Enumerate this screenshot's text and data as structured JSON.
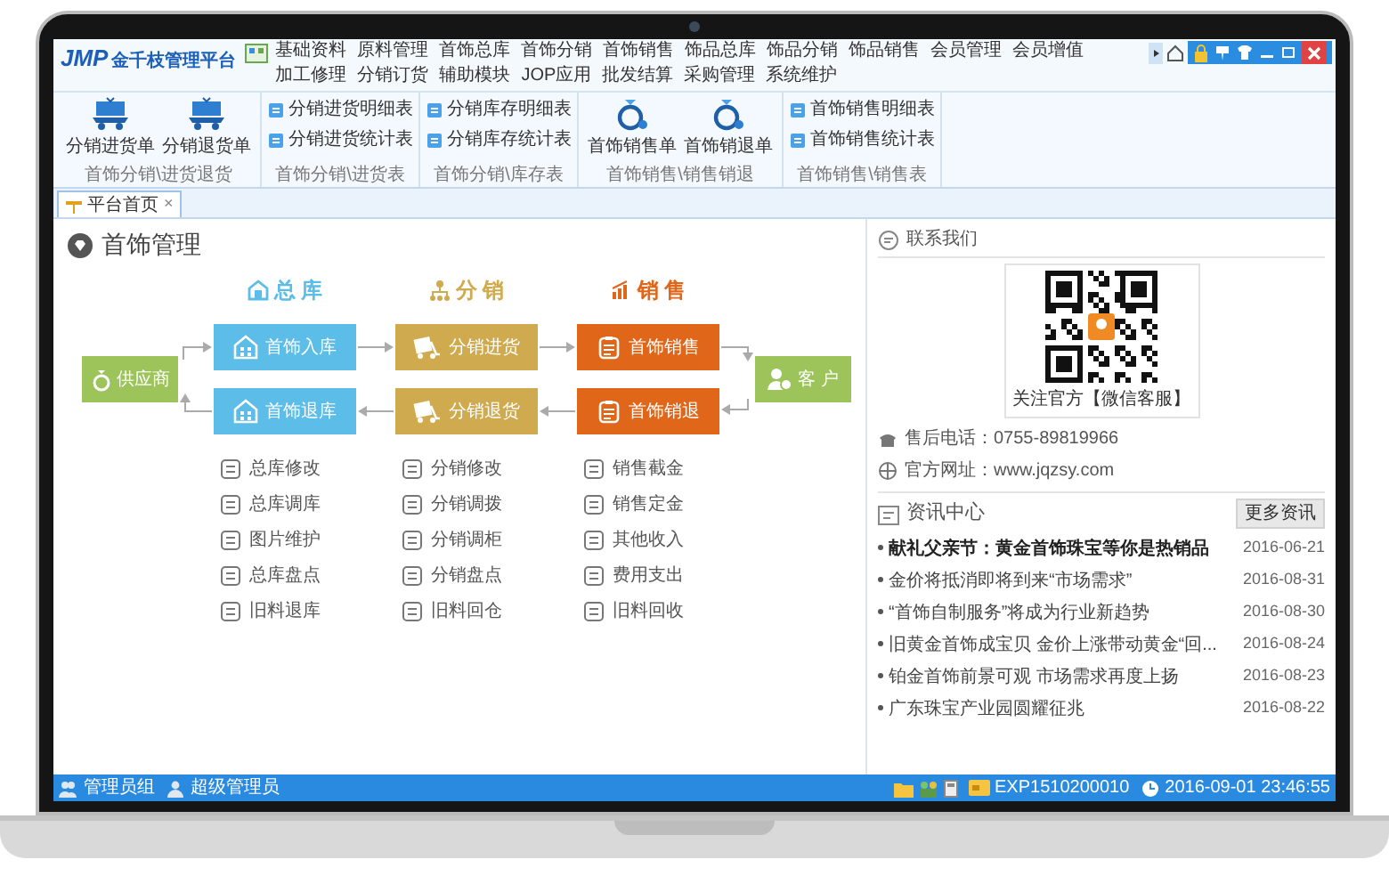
{
  "app": {
    "logo": "JMP",
    "title": "金千枝管理平台"
  },
  "menu": [
    "基础资料",
    "原料管理",
    "首饰总库",
    "首饰分销",
    "首饰销售",
    "饰品总库",
    "饰品分销",
    "饰品销售",
    "会员管理",
    "会员增值",
    "加工修理",
    "分销订货",
    "辅助模块",
    "JOP应用",
    "批发结算",
    "采购管理",
    "系统维护"
  ],
  "ribbon_groups": [
    {
      "label": "首饰分销\\进货退货",
      "items": [
        {
          "label": "分销进货单",
          "kind": "large"
        },
        {
          "label": "分销退货单",
          "kind": "large"
        }
      ]
    },
    {
      "label": "首饰分销\\进货表",
      "items": [
        {
          "label": "分销进货明细表",
          "kind": "small"
        },
        {
          "label": "分销进货统计表",
          "kind": "small"
        }
      ]
    },
    {
      "label": "首饰分销\\库存表",
      "items": [
        {
          "label": "分销库存明细表",
          "kind": "small"
        },
        {
          "label": "分销库存统计表",
          "kind": "small"
        }
      ]
    },
    {
      "label": "首饰销售\\销售销退",
      "items": [
        {
          "label": "首饰销售单",
          "kind": "large"
        },
        {
          "label": "首饰销退单",
          "kind": "large"
        }
      ]
    },
    {
      "label": "首饰销售\\销售表",
      "items": [
        {
          "label": "首饰销售明细表",
          "kind": "small"
        },
        {
          "label": "首饰销售统计表",
          "kind": "small"
        }
      ]
    }
  ],
  "tabs": [
    {
      "label": "平台首页",
      "selected": true,
      "close": "×"
    }
  ],
  "page_title": "首饰管理",
  "flow": {
    "supplier": "供应商",
    "customer": "客 户",
    "columns": [
      {
        "title": "总 库",
        "color": "#5bbde8",
        "forward": "首饰入库",
        "back": "首饰退库",
        "functions": [
          "总库修改",
          "总库调库",
          "图片维护",
          "总库盘点",
          "旧料退库"
        ]
      },
      {
        "title": "分 销",
        "color": "#cfaa4e",
        "forward": "分销进货",
        "back": "分销退货",
        "functions": [
          "分销修改",
          "分销调拨",
          "分销调柜",
          "分销盘点",
          "旧料回仓"
        ]
      },
      {
        "title": "销 售",
        "color": "#e0661a",
        "forward": "首饰销售",
        "back": "首饰销退",
        "functions": [
          "销售截金",
          "销售定金",
          "其他收入",
          "费用支出",
          "旧料回收"
        ]
      }
    ]
  },
  "contact": {
    "title": "联系我们",
    "qr_caption": "关注官方【微信客服】",
    "phone": "售后电话：0755-89819966",
    "website": "官方网址：www.jqzsy.com"
  },
  "news": {
    "title": "资讯中心",
    "more": "更多资讯",
    "items": [
      {
        "title": "献礼父亲节：黄金首饰珠宝等你是热销品",
        "date": "2016-06-21",
        "bold": true
      },
      {
        "title": "金价将抵消即将到来“市场需求”",
        "date": "2016-08-31",
        "bold": false
      },
      {
        "title": "“首饰自制服务”将成为行业新趋势",
        "date": "2016-08-30",
        "bold": false
      },
      {
        "title": "旧黄金首饰成宝贝 金价上涨带动黄金“回...",
        "date": "2016-08-24",
        "bold": false
      },
      {
        "title": "铂金首饰前景可观 市场需求再度上扬",
        "date": "2016-08-23",
        "bold": false
      },
      {
        "title": "广东珠宝产业园圆耀征兆",
        "date": "2016-08-22",
        "bold": false
      }
    ]
  },
  "status": {
    "group": "管理员组",
    "user": "超级管理员",
    "code": "EXP1510200010",
    "datetime": "2016-09-01 23:46:55"
  }
}
